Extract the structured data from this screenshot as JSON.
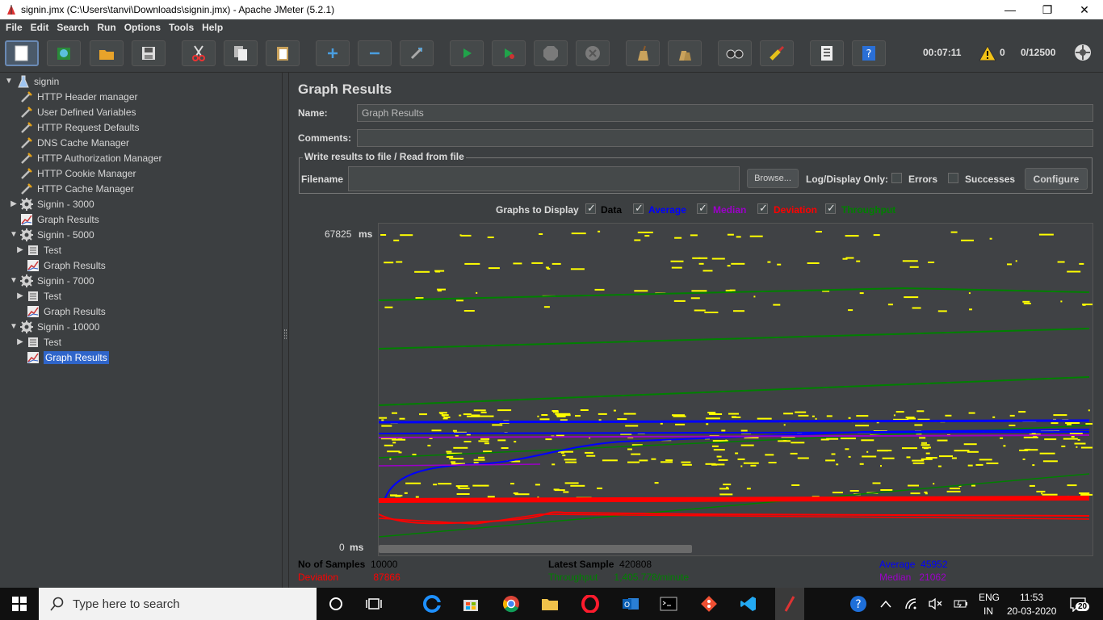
{
  "window": {
    "title": "signin.jmx (C:\\Users\\tanvi\\Downloads\\signin.jmx) - Apache JMeter (5.2.1)",
    "controls": [
      "—",
      "❐",
      "✕"
    ]
  },
  "menu": [
    "File",
    "Edit",
    "Search",
    "Run",
    "Options",
    "Tools",
    "Help"
  ],
  "toolbar": {
    "buttons": [
      "new-icon",
      "templates-icon",
      "open-icon",
      "save-icon",
      "cut-icon",
      "copy-icon",
      "paste-icon",
      "expand-icon",
      "collapse-icon",
      "toggle-icon",
      "start-icon",
      "start-no-pause-icon",
      "stop-icon",
      "shutdown-icon",
      "clear-icon",
      "clear-all-icon",
      "search-icon",
      "reset-search-icon",
      "function-helper-icon",
      "help-icon"
    ],
    "elapsed": "00:07:11",
    "warnings": "0",
    "threads": "0/12500"
  },
  "tree": {
    "root": "signin",
    "items": [
      {
        "label": "HTTP Header manager",
        "icon": "wrench-icon"
      },
      {
        "label": "User Defined Variables",
        "icon": "wrench-icon"
      },
      {
        "label": "HTTP Request Defaults",
        "icon": "wrench-icon"
      },
      {
        "label": "DNS Cache Manager",
        "icon": "wrench-icon"
      },
      {
        "label": "HTTP Authorization Manager",
        "icon": "wrench-icon"
      },
      {
        "label": "HTTP Cookie Manager",
        "icon": "wrench-icon"
      },
      {
        "label": "HTTP Cache Manager",
        "icon": "wrench-icon"
      },
      {
        "label": "Signin - 3000",
        "icon": "thread-group-icon"
      },
      {
        "label": "Graph Results",
        "icon": "graph-icon"
      },
      {
        "label": "Signin - 5000",
        "icon": "thread-group-icon"
      },
      {
        "label": "Test",
        "icon": "controller-icon"
      },
      {
        "label": "Graph Results",
        "icon": "graph-icon"
      },
      {
        "label": "Signin - 7000",
        "icon": "thread-group-icon"
      },
      {
        "label": "Test",
        "icon": "controller-icon"
      },
      {
        "label": "Graph Results",
        "icon": "graph-icon"
      },
      {
        "label": "Signin - 10000",
        "icon": "thread-group-icon"
      },
      {
        "label": "Test",
        "icon": "controller-icon"
      },
      {
        "label": "Graph Results",
        "icon": "graph-icon"
      }
    ]
  },
  "panel": {
    "title": "Graph Results",
    "name_label": "Name:",
    "name_value": "Graph Results",
    "comments_label": "Comments:",
    "comments_value": "",
    "file_legend": "Write results to file / Read from file",
    "filename_label": "Filename",
    "filename_value": "",
    "browse": "Browse...",
    "log_display": "Log/Display Only:",
    "errors": "Errors",
    "successes": "Successes",
    "configure": "Configure",
    "graphs_to_display": "Graphs to Display",
    "series": [
      {
        "name": "Data",
        "color": "#000000",
        "checked": true
      },
      {
        "name": "Average",
        "color": "#0000ff",
        "checked": true
      },
      {
        "name": "Median",
        "color": "#9c00c8",
        "checked": true
      },
      {
        "name": "Deviation",
        "color": "#ff0000",
        "checked": true
      },
      {
        "name": "Throughput",
        "color": "#008000",
        "checked": true
      }
    ],
    "y_max": "67825",
    "y_min": "0",
    "y_unit": "ms"
  },
  "stats": {
    "samples_label": "No of Samples",
    "samples": "10000",
    "latest_label": "Latest Sample",
    "latest": "420808",
    "average_label": "Average",
    "average": "45952",
    "deviation_label": "Deviation",
    "deviation": "87866",
    "throughput_label": "Throughput",
    "throughput": "1,405.778/minute",
    "median_label": "Median",
    "median": "21062"
  },
  "taskbar": {
    "search_placeholder": "Type here to search",
    "lang_top": "ENG",
    "lang_bottom": "IN",
    "time": "11:53",
    "date": "20-03-2020",
    "notifications": "20"
  }
}
